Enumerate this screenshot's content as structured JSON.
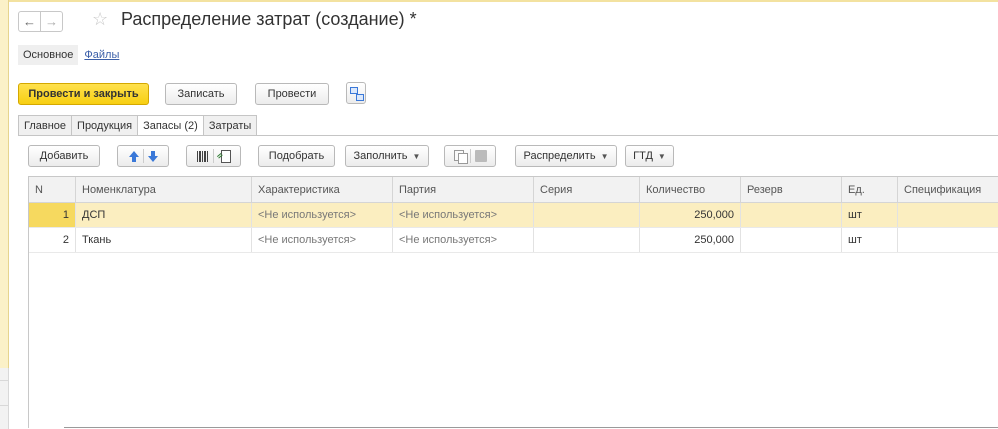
{
  "window": {
    "title": "Распределение затрат (создание) *"
  },
  "subnav": {
    "main": "Основное",
    "files": "Файлы"
  },
  "toolbar": {
    "post_close": "Провести и закрыть",
    "save": "Записать",
    "post": "Провести"
  },
  "tabs": [
    {
      "label": "Главное"
    },
    {
      "label": "Продукция"
    },
    {
      "label": "Запасы (2)"
    },
    {
      "label": "Затраты"
    }
  ],
  "table_toolbar": {
    "add": "Добавить",
    "pick": "Подобрать",
    "fill": "Заполнить",
    "distribute": "Распределить",
    "gtd": "ГТД"
  },
  "table": {
    "columns": [
      "N",
      "Номенклатура",
      "Характеристика",
      "Партия",
      "Серия",
      "Количество",
      "Резерв",
      "Ед.",
      "Спецификация"
    ],
    "rows": [
      {
        "n": "1",
        "nom": "ДСП",
        "char": "<Не используется>",
        "party": "<Не используется>",
        "series": "",
        "qty": "250,000",
        "res": "",
        "ed": "шт",
        "spec": ""
      },
      {
        "n": "2",
        "nom": "Ткань",
        "char": "<Не используется>",
        "party": "<Не используется>",
        "series": "",
        "qty": "250,000",
        "res": "",
        "ed": "шт",
        "spec": ""
      }
    ]
  },
  "colors": {
    "primary": "#f7cf12",
    "selected_row": "#fbeec0",
    "link": "#3a5ea8"
  }
}
